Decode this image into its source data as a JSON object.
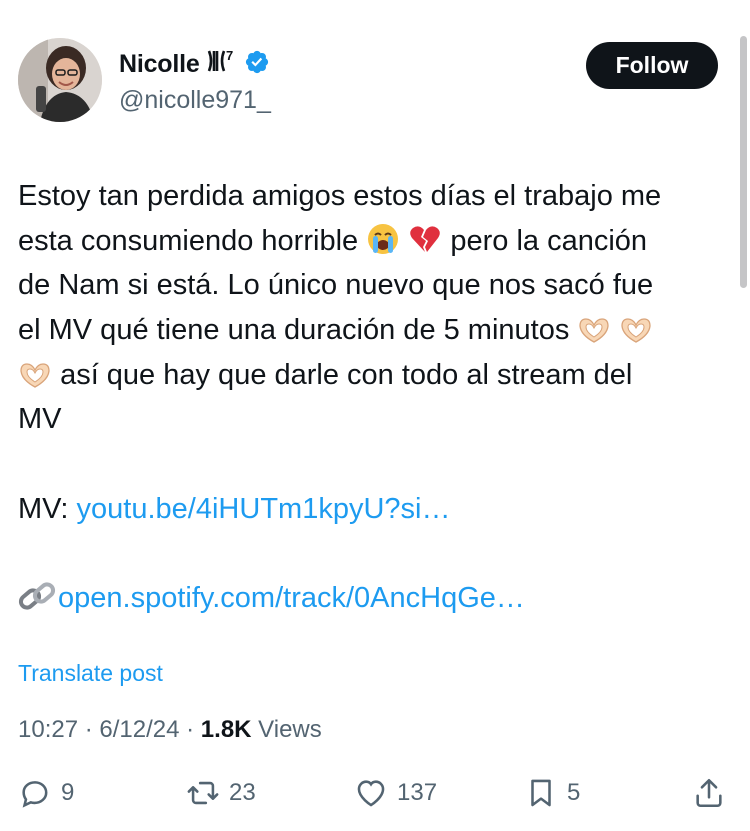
{
  "user": {
    "name": "Nicolle",
    "army_emblem": "⼀⩿",
    "superscript": "7",
    "handle": "@nicolle971_",
    "verified": true
  },
  "follow_button": {
    "label": "Follow"
  },
  "post": {
    "line1": "Estoy tan perdida amigos estos días el trabajo me",
    "line2_a": "esta consumiendo horrible",
    "line2_b": "pero la canción",
    "line3": "de Nam si está. Lo único nuevo que nos sacó fue",
    "line4": "el MV qué tiene una duración de 5 minutos",
    "line5": "así que hay que darle con todo al stream del",
    "line6": "MV",
    "mv_prefix": "MV: ",
    "youtube_link": "youtu.be/4iHUTm1kpyU?si…",
    "spotify_link": "open.spotify.com/track/0AncHqGe…",
    "emojis": [
      "loudly-crying-face",
      "broken-heart",
      "heart-hands",
      "heart-hands",
      "heart-hands",
      "link"
    ]
  },
  "translate": {
    "label": "Translate post"
  },
  "meta": {
    "time": "10:27",
    "date": "6/12/24",
    "sep": " · ",
    "views_count": "1.8K",
    "views_label": "Views"
  },
  "actions": {
    "replies": "9",
    "reposts": "23",
    "likes": "137",
    "bookmarks": "5"
  },
  "colors": {
    "text": "#0f1419",
    "secondary": "#536471",
    "link": "#1d9bf0",
    "verified": "#1d9bf0",
    "button_bg": "#0f1419"
  }
}
